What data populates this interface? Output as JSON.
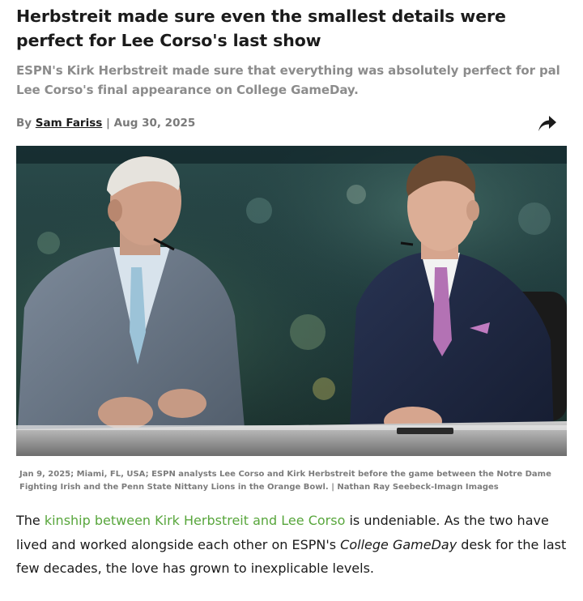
{
  "article": {
    "headline": "Herbstreit made sure even the smallest details were perfect for Lee Corso's last show",
    "dek": "ESPN's Kirk Herbstreit made sure that everything was absolutely perfect for pal Lee Corso's final appearance on College GameDay.",
    "byline": {
      "prefix": "By",
      "author": "Sam Fariss",
      "separator": "|",
      "date": "Aug 30, 2025"
    },
    "share_icon": "share-arrow-icon",
    "image": {
      "subject": "Lee Corso and Kirk Herbstreit at the College GameDay desk"
    },
    "caption": "Jan 9, 2025; Miami, FL, USA; ESPN analysts Lee Corso and Kirk Herbstreit before the game between the Notre Dame Fighting Irish and the Penn State Nittany Lions in the Orange Bowl. | Nathan Ray Seebeck-Imagn Images",
    "body": {
      "intro": "The ",
      "link_text": "kinship between Kirk Herbstreit and Lee Corso",
      "part2": " is undeniable. As the two have lived and worked alongside each other on ESPN's ",
      "show_name": "College GameDay",
      "part3": " desk for the last few decades, the love has grown to inexplicable levels."
    }
  },
  "colors": {
    "headline": "#1b1b1b",
    "dek": "#8c8c8c",
    "meta": "#7a7a7a",
    "link": "#58a63c"
  }
}
